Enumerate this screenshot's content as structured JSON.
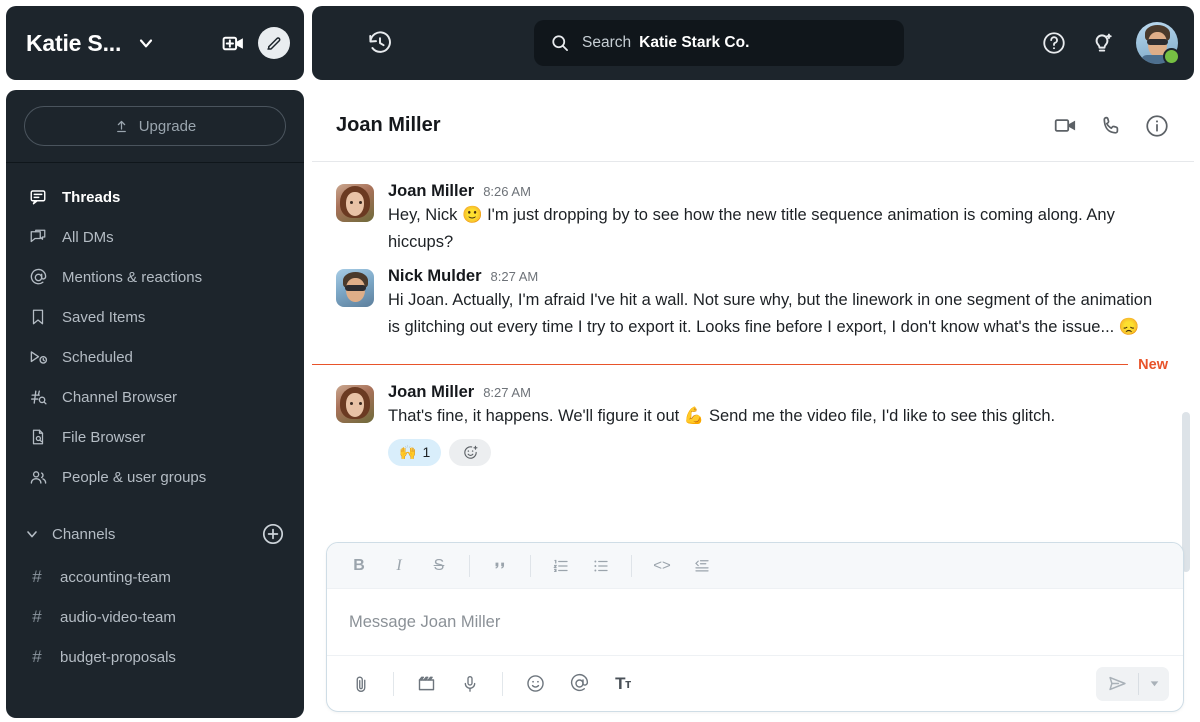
{
  "workspace": {
    "name": "Katie S...",
    "full_name": "Katie Stark Co.",
    "chevron_icon": "chevron-down-icon",
    "new_call_icon": "video-add-icon",
    "compose_icon": "compose-icon"
  },
  "sidebar": {
    "upgrade_label": "Upgrade",
    "upgrade_icon": "upload-arrow-icon",
    "items": [
      {
        "label": "Threads",
        "icon": "threads-icon",
        "active": true
      },
      {
        "label": "All DMs",
        "icon": "dms-icon",
        "active": false
      },
      {
        "label": "Mentions & reactions",
        "icon": "at-icon",
        "active": false
      },
      {
        "label": "Saved Items",
        "icon": "bookmark-icon",
        "active": false
      },
      {
        "label": "Scheduled",
        "icon": "scheduled-send-icon",
        "active": false
      },
      {
        "label": "Channel Browser",
        "icon": "channel-search-icon",
        "active": false
      },
      {
        "label": "File Browser",
        "icon": "file-search-icon",
        "active": false
      },
      {
        "label": "People & user groups",
        "icon": "people-icon",
        "active": false
      }
    ],
    "channels_section": {
      "title": "Channels",
      "caret_icon": "chevron-down-icon",
      "add_icon": "plus-circle-icon",
      "channels": [
        {
          "prefix": "#",
          "name": "accounting-team"
        },
        {
          "prefix": "#",
          "name": "audio-video-team"
        },
        {
          "prefix": "#",
          "name": "budget-proposals"
        }
      ]
    }
  },
  "topbar": {
    "history_icon": "history-clock-icon",
    "search": {
      "icon": "search-icon",
      "label": "Search",
      "workspace": "Katie Stark Co."
    },
    "help_icon": "help-circle-icon",
    "ai_icon": "ai-lightbulb-icon",
    "avatar": {
      "name": "avatar",
      "presence": "active",
      "presence_color": "#76c043"
    }
  },
  "conversation": {
    "title": "Joan Miller",
    "header_icons": [
      {
        "name": "video-call-icon"
      },
      {
        "name": "phone-call-icon"
      },
      {
        "name": "info-icon"
      }
    ],
    "new_divider_label": "New",
    "new_divider_color": "#e8532a",
    "messages": [
      {
        "author": "Joan Miller",
        "time": "8:26 AM",
        "avatar": "joan",
        "text": "Hey, Nick 🙂 I'm just dropping by to see how the new title sequence animation is coming along. Any hiccups?",
        "reactions": []
      },
      {
        "author": "Nick Mulder",
        "time": "8:27 AM",
        "avatar": "nick",
        "text": "Hi Joan. Actually, I'm afraid I've hit a wall. Not sure why, but the linework in one segment of the animation is glitching out every time I try to export it. Looks fine before I export, I don't know what's the issue... 😞",
        "reactions": []
      },
      {
        "author": "Joan Miller",
        "time": "8:27 AM",
        "avatar": "joan",
        "text": "That's fine, it happens. We'll figure it out 💪 Send me the video file, I'd like to see this glitch.",
        "reactions": [
          {
            "emoji": "🙌",
            "count": "1"
          }
        ],
        "add_reaction_icon": "add-reaction-icon"
      }
    ]
  },
  "composer": {
    "placeholder": "Message Joan Miller",
    "format_buttons": [
      {
        "name": "bold-icon",
        "glyph": "B"
      },
      {
        "name": "italic-icon",
        "glyph": "I"
      },
      {
        "name": "strikethrough-icon",
        "glyph": "S"
      },
      {
        "name": "blockquote-icon",
        "glyph": "❞"
      },
      {
        "name": "ordered-list-icon",
        "glyph": ""
      },
      {
        "name": "bulleted-list-icon",
        "glyph": ""
      },
      {
        "name": "code-icon",
        "glyph": "<>"
      },
      {
        "name": "code-block-icon",
        "glyph": ""
      }
    ],
    "action_buttons": [
      {
        "name": "attachment-icon"
      },
      {
        "name": "video-clip-icon"
      },
      {
        "name": "microphone-icon"
      },
      {
        "name": "emoji-icon"
      },
      {
        "name": "mention-icon"
      },
      {
        "name": "format-text-icon"
      }
    ],
    "send_icon": "send-icon",
    "send_options_icon": "chevron-down-icon"
  }
}
